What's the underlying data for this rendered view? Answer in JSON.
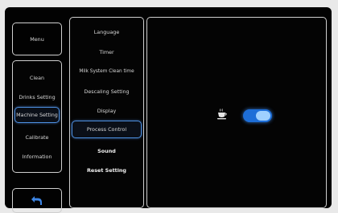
{
  "menu": {
    "label": "Menu"
  },
  "categories": [
    {
      "label": "Clean",
      "active": false
    },
    {
      "label": "Drinks Setting",
      "active": false
    },
    {
      "label": "Machine Setting",
      "active": true
    },
    {
      "label": "Calibrate",
      "active": false
    },
    {
      "label": "Information",
      "active": false
    }
  ],
  "settings": [
    {
      "label": "Language",
      "active": false,
      "bold": false
    },
    {
      "label": "Timer",
      "active": false,
      "bold": false
    },
    {
      "label": "Milk System Clean time",
      "active": false,
      "bold": false
    },
    {
      "label": "Descaling Setting",
      "active": false,
      "bold": false
    },
    {
      "label": "Display",
      "active": false,
      "bold": false
    },
    {
      "label": "Process Control",
      "active": true,
      "bold": false
    },
    {
      "label": "Sound",
      "active": false,
      "bold": true
    },
    {
      "label": "Reset Setting",
      "active": false,
      "bold": true
    }
  ],
  "detail": {
    "icon": "coffee-cup-icon",
    "toggle_on": true
  },
  "back": {
    "icon": "back-arrow-icon"
  },
  "colors": {
    "accent": "#4c8fe0",
    "toggle": "#1d6ed8",
    "border": "#cfcfcf",
    "background": "#020202"
  }
}
